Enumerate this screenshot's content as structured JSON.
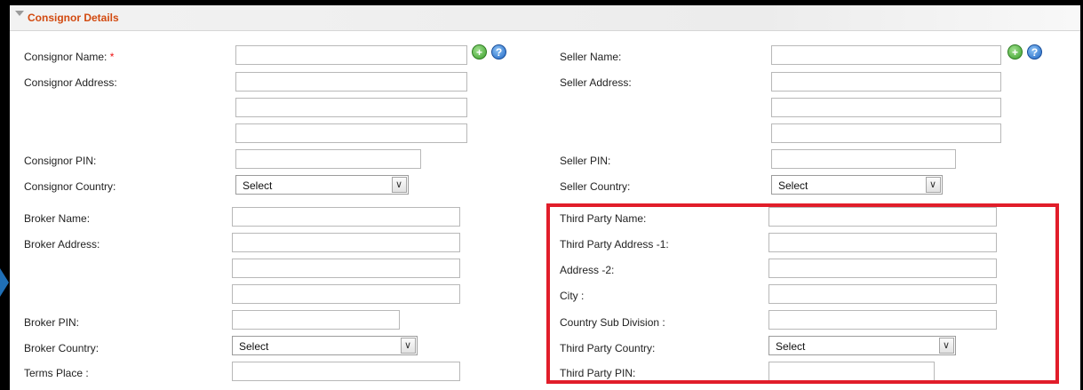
{
  "section": {
    "title": "Consignor Details"
  },
  "consignor": {
    "name_label": "Consignor Name:",
    "required_mark": "*",
    "address_label": "Consignor Address:",
    "pin_label": "Consignor PIN:",
    "country_label": "Consignor Country:",
    "country_value": "Select"
  },
  "seller": {
    "name_label": "Seller Name:",
    "address_label": "Seller Address:",
    "pin_label": "Seller PIN:",
    "country_label": "Seller Country:",
    "country_value": "Select"
  },
  "broker": {
    "name_label": "Broker Name:",
    "address_label": "Broker Address:",
    "pin_label": "Broker PIN:",
    "country_label": "Broker Country:",
    "country_value": "Select",
    "terms_place_label": "Terms Place :"
  },
  "third_party": {
    "name_label": "Third Party Name:",
    "address1_label": "Third Party Address -1:",
    "address2_label": "Address -2:",
    "city_label": "City :",
    "subdivision_label": "Country Sub Division :",
    "country_label": "Third Party Country:",
    "country_value": "Select",
    "pin_label": "Third Party PIN:"
  },
  "icons": {
    "add": "add-icon",
    "help": "help-icon",
    "dropdown": "chevron-down-icon"
  },
  "colors": {
    "header_text": "#d24a10",
    "required": "#ee1111",
    "highlight_box": "#e11d2a"
  }
}
